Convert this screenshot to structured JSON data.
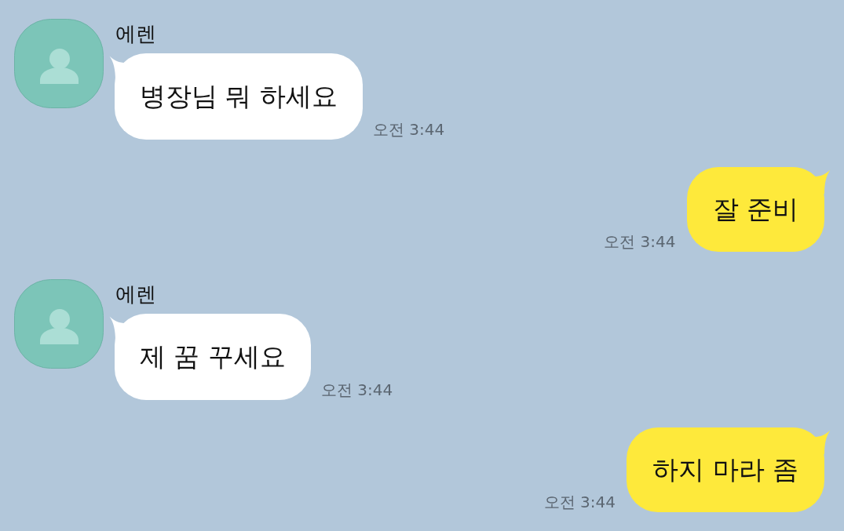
{
  "messages": [
    {
      "kind": "received",
      "sender": "에렌",
      "text": "병장님 뭐 하세요",
      "time": "오전 3:44"
    },
    {
      "kind": "sent",
      "text": "잘 준비",
      "time": "오전 3:44"
    },
    {
      "kind": "received",
      "sender": "에렌",
      "text": "제 꿈 꾸세요",
      "time": "오전 3:44"
    },
    {
      "kind": "sent",
      "text": "하지 마라 좀",
      "time": "오전 3:44"
    }
  ]
}
